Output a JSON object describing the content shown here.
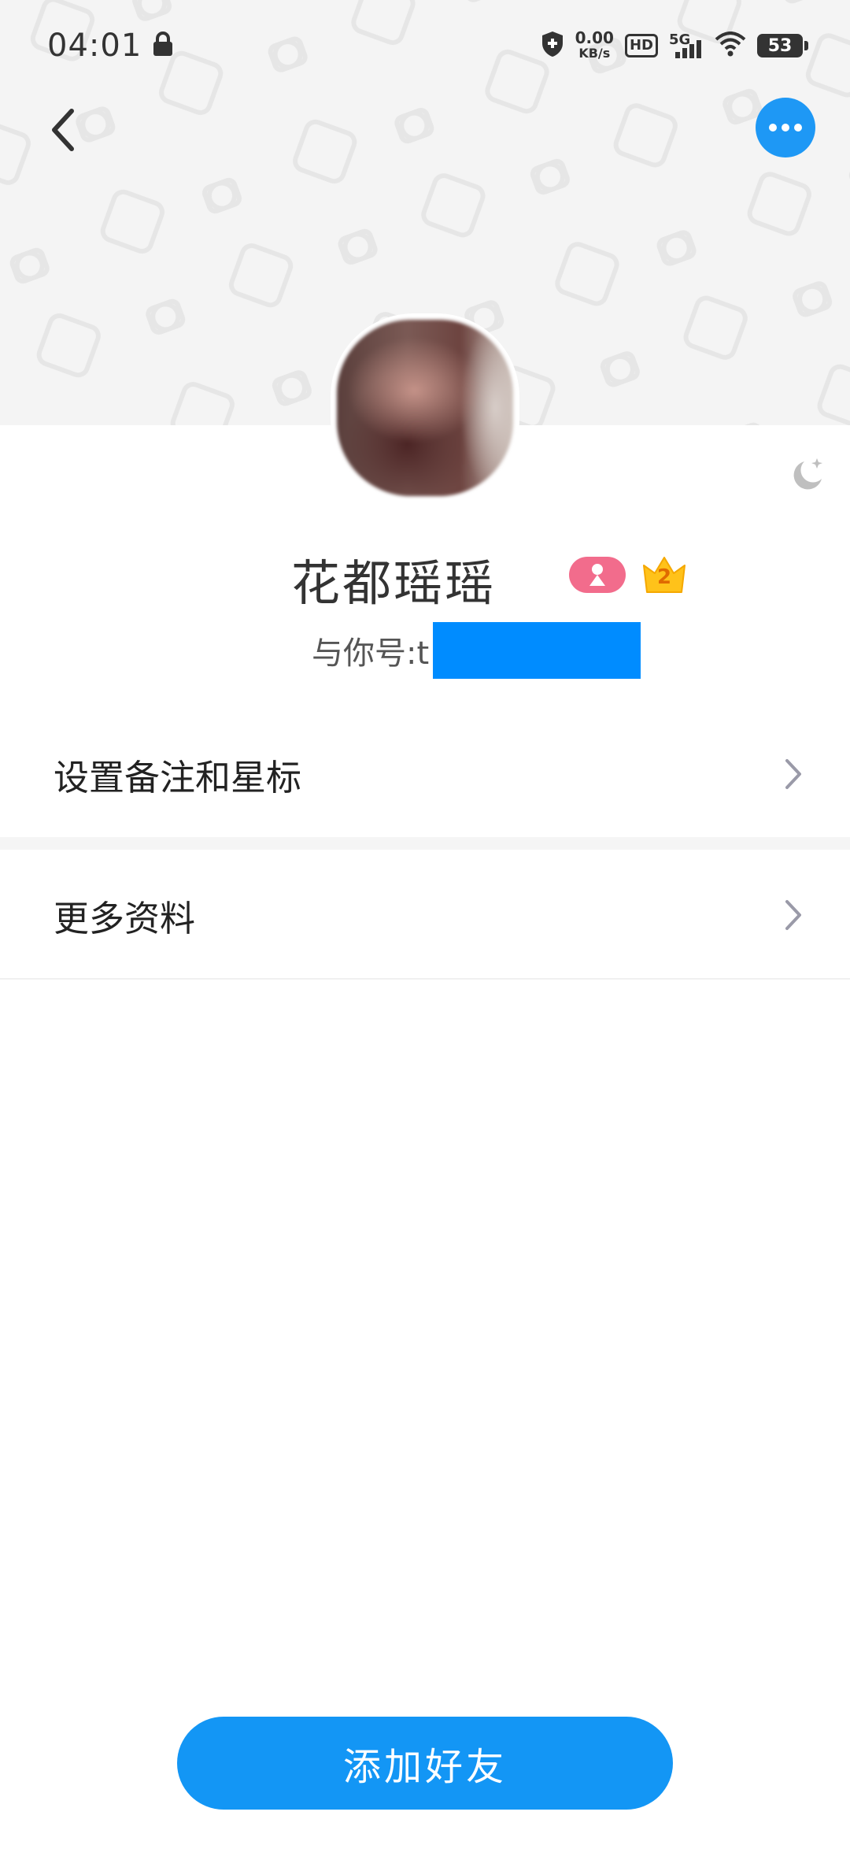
{
  "status_bar": {
    "time": "04:01",
    "speed_value": "0.00",
    "speed_unit": "KB/s",
    "hd": "HD",
    "network": "5G",
    "battery": "53"
  },
  "profile": {
    "name": "花都瑶瑶",
    "relation_prefix": "与你号:t",
    "vip_level": "2"
  },
  "menu": {
    "remark_label": "设置备注和星标",
    "more_info_label": "更多资料"
  },
  "actions": {
    "add_friend_label": "添加好友"
  },
  "colors": {
    "accent": "#1396f5",
    "gender_badge": "#f26c8c",
    "vip_badge": "#ffc21a"
  }
}
